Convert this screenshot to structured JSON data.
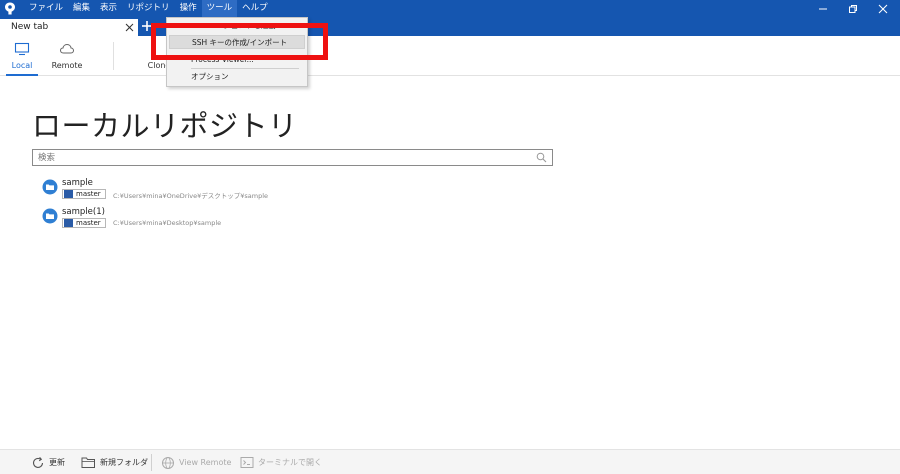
{
  "colors": {
    "brand": "#1556b0",
    "accent": "#1e6cd1",
    "highlight": "#ee1111"
  },
  "menubar": {
    "items": [
      "ファイル",
      "編集",
      "表示",
      "リポジトリ",
      "操作",
      "ツール",
      "ヘルプ"
    ],
    "active": "ツール"
  },
  "window_controls": [
    "minimize-icon",
    "restore-icon",
    "close-icon"
  ],
  "tab": {
    "label": "New tab"
  },
  "toolbar": {
    "local_label": "Local",
    "remote_label": "Remote",
    "clone_label": "Clone"
  },
  "tools_menu": {
    "items": [
      {
        "label": "SSH エージェントを起動...",
        "state": "partially-hidden"
      },
      {
        "label": "SSH キーの作成/インポート",
        "state": "hover"
      },
      {
        "label": "Process Viewer...",
        "state": "partially-hidden"
      },
      {
        "label": "オプション",
        "state": "normal"
      }
    ]
  },
  "main": {
    "title": "ローカルリポジトリ",
    "search_placeholder": "検索"
  },
  "repositories": [
    {
      "name": "sample",
      "branch": "master",
      "path": "C:¥Users¥mina¥OneDrive¥デスクトップ¥sample"
    },
    {
      "name": "sample(1)",
      "branch": "master",
      "path": "C:¥Users¥mina¥Desktop¥sample"
    }
  ],
  "statusbar": {
    "refresh_label": "更新",
    "new_folder_label": "新規フォルダ",
    "view_remote_label": "View Remote",
    "terminal_label": "ターミナルで開く"
  }
}
